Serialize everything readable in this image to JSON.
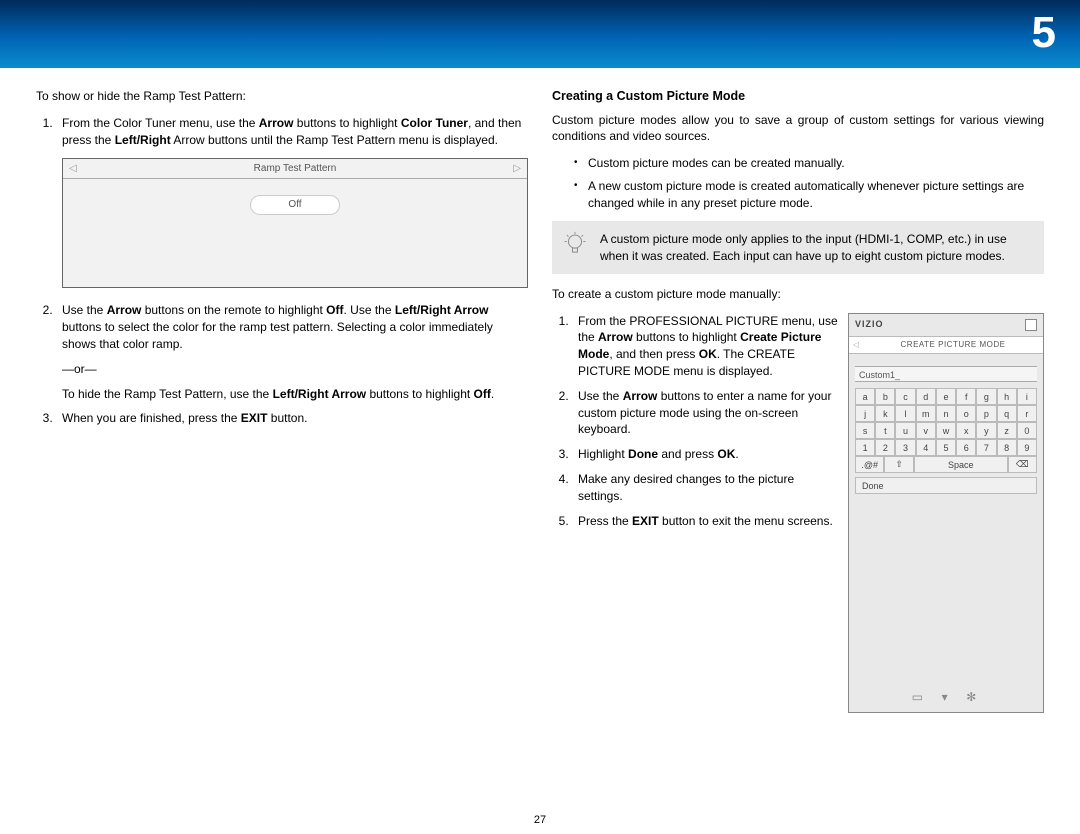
{
  "banner": {
    "chapter": "5"
  },
  "left": {
    "lead": "To show or hide the Ramp Test Pattern:",
    "step1_a": "From the Color Tuner menu, use the ",
    "step1_b": "Arrow",
    "step1_c": " buttons to highlight ",
    "step1_d": "Color Tuner",
    "step1_e": ", and then press the ",
    "step1_f": "Left/Right",
    "step1_g": " Arrow buttons until the Ramp Test Pattern menu is displayed.",
    "ramp_title": "Ramp Test Pattern",
    "ramp_value": "Off",
    "step2_a": "Use the ",
    "step2_b": "Arrow",
    "step2_c": " buttons on the remote to highlight ",
    "step2_d": "Off",
    "step2_e": ". Use the ",
    "step2_f": "Left/Right Arrow",
    "step2_g": " buttons to select the color for the ramp test pattern. Selecting a color immediately shows that color ramp.",
    "or": "—or—",
    "step2h_a": "To hide the Ramp Test Pattern, use the ",
    "step2h_b": "Left/Right Arrow",
    "step2h_c": " buttons to highlight ",
    "step2h_d": "Off",
    "step2h_e": ".",
    "step3_a": "When you are finished, press the ",
    "step3_b": "EXIT",
    "step3_c": " button."
  },
  "right": {
    "heading": "Creating a Custom Picture Mode",
    "intro": "Custom picture modes allow you to save a group of custom settings for various viewing conditions and video sources.",
    "bullet1": "Custom picture modes can be created manually.",
    "bullet2": "A new custom picture mode is created automatically whenever picture settings are changed while in any preset picture mode.",
    "note": "A custom picture mode only applies to the input (HDMI-1, COMP, etc.) in use when it was created. Each input can have up to eight custom picture modes.",
    "lead2": "To create a custom picture mode manually:",
    "s1_a": "From the PROFESSIONAL PICTURE menu, use the ",
    "s1_b": "Arrow",
    "s1_c": " buttons to highlight ",
    "s1_d": "Create Picture Mode",
    "s1_e": ", and then press ",
    "s1_f": "OK",
    "s1_g": ". The CREATE PICTURE MODE menu is displayed.",
    "s2_a": "Use the ",
    "s2_b": "Arrow",
    "s2_c": " buttons to enter a name for your custom picture mode using the on-screen keyboard.",
    "s3_a": "Highlight ",
    "s3_b": "Done",
    "s3_c": " and press ",
    "s3_d": "OK",
    "s3_e": ".",
    "s4": "Make any desired changes to the picture settings.",
    "s5_a": "Press the ",
    "s5_b": "EXIT",
    "s5_c": " button to exit the menu screens."
  },
  "device": {
    "brand": "VIZIO",
    "bar_label": "CREATE PICTURE MODE",
    "input_value": "Custom1_",
    "rows": [
      [
        "a",
        "b",
        "c",
        "d",
        "e",
        "f",
        "g",
        "h",
        "i"
      ],
      [
        "j",
        "k",
        "l",
        "m",
        "n",
        "o",
        "p",
        "q",
        "r"
      ],
      [
        "s",
        "t",
        "u",
        "v",
        "w",
        "x",
        "y",
        "z",
        "0"
      ],
      [
        "1",
        "2",
        "3",
        "4",
        "5",
        "6",
        "7",
        "8",
        "9"
      ]
    ],
    "sym": ".@#",
    "space": "Space",
    "done": "Done"
  },
  "page_number": "27"
}
